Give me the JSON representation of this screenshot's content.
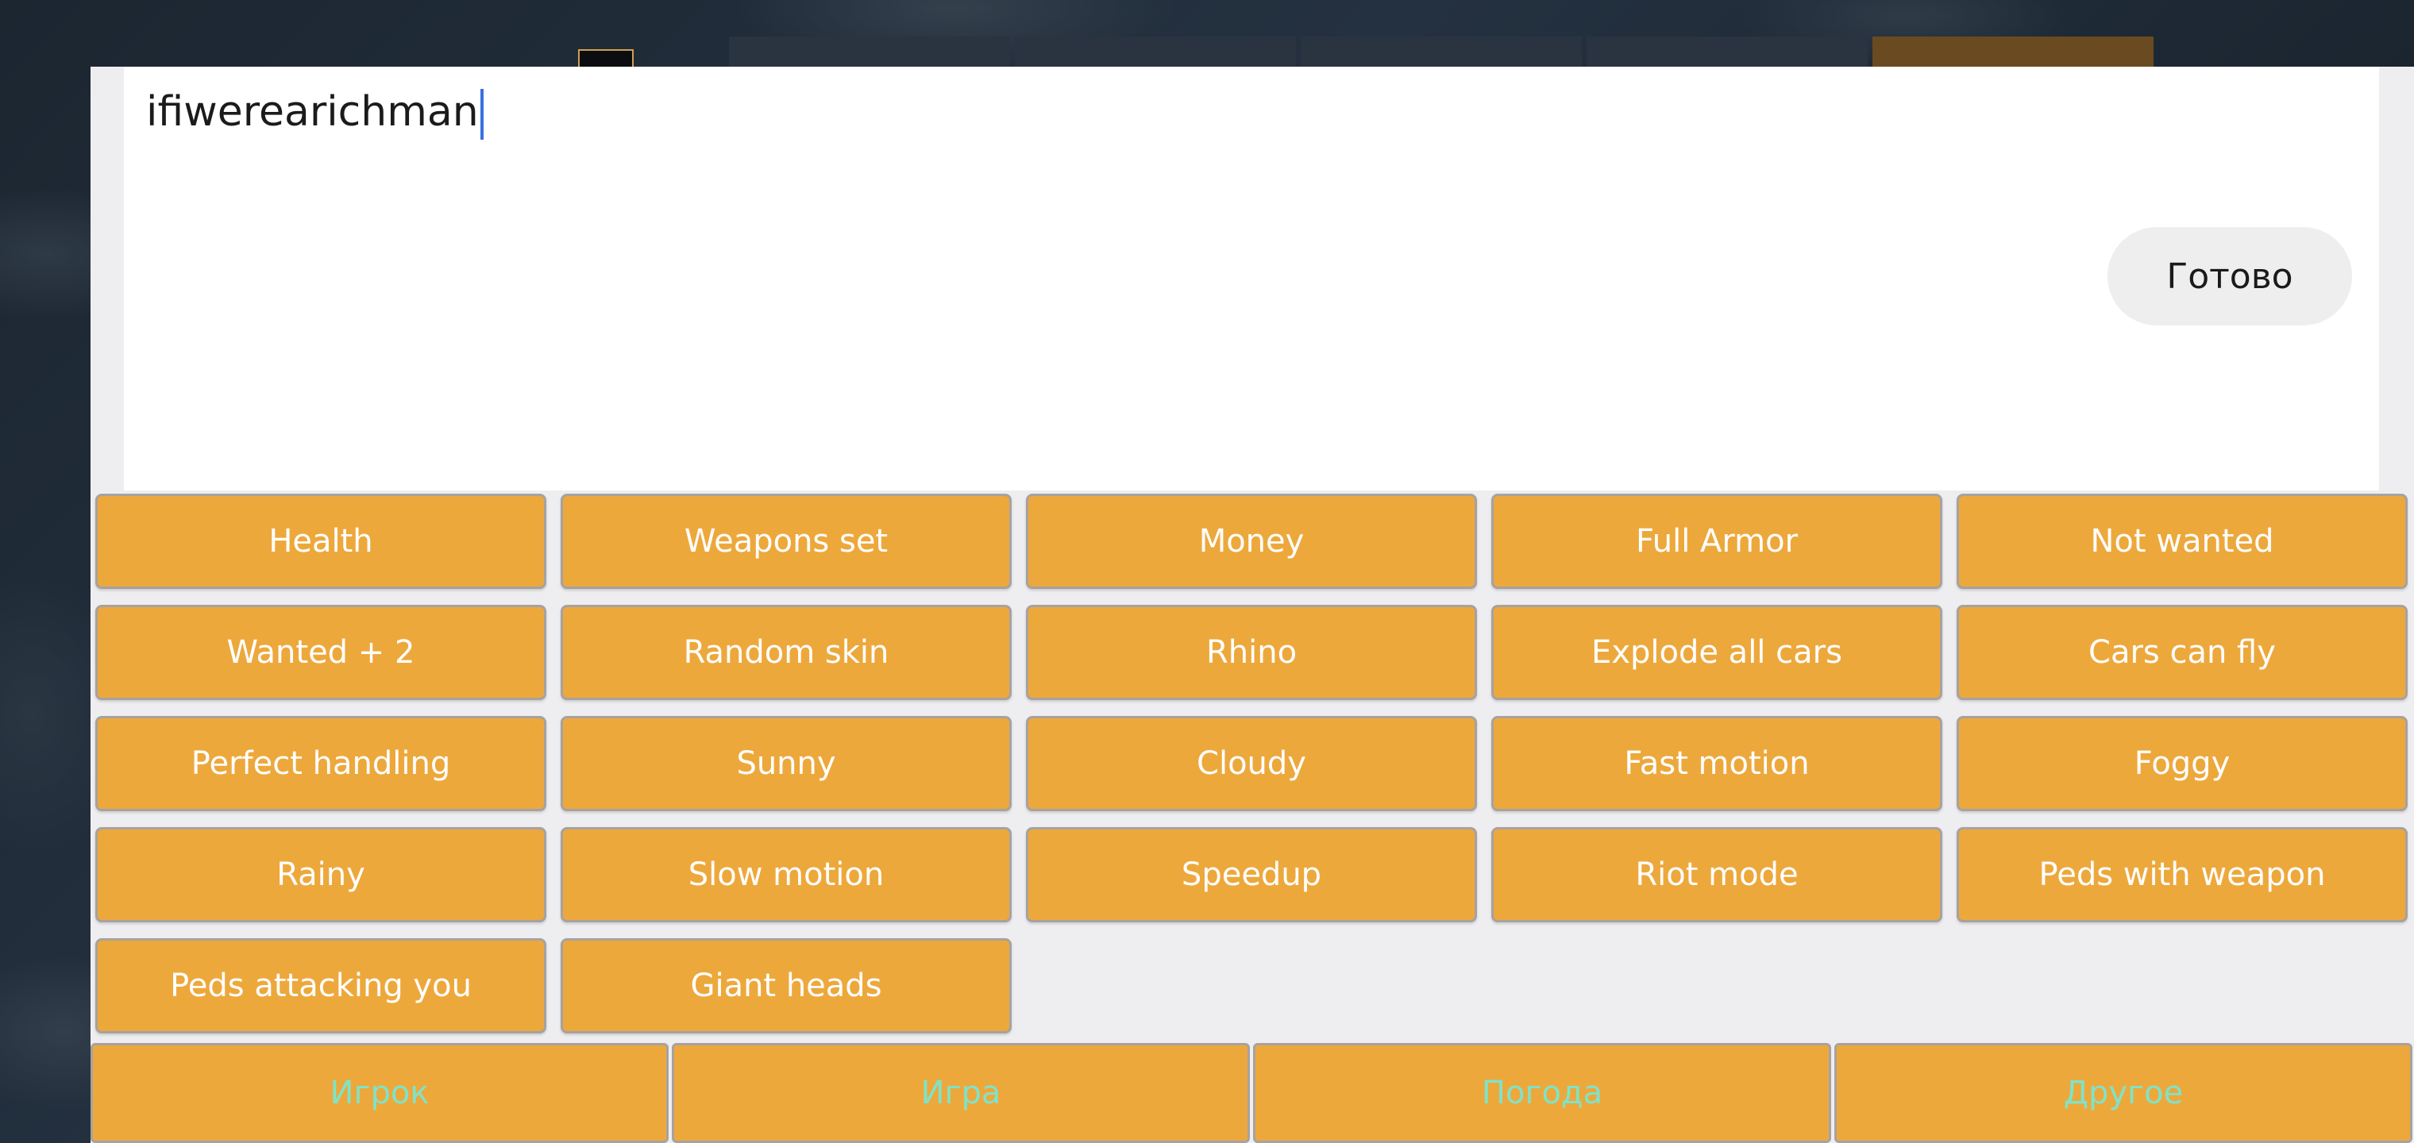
{
  "input": {
    "value": "ifiwerearichman"
  },
  "done_button": {
    "label": "Готово"
  },
  "cheats": [
    "Health",
    "Weapons set",
    "Money",
    "Full Armor",
    "Not wanted",
    "Wanted + 2",
    "Random skin",
    "Rhino",
    "Explode all cars",
    "Cars can fly",
    "Perfect handling",
    "Sunny",
    "Cloudy",
    "Fast motion",
    "Foggy",
    "Rainy",
    "Slow motion",
    "Speedup",
    "Riot mode",
    "Peds with weapon",
    "Peds attacking you",
    "Giant heads"
  ],
  "tabs": [
    "Игрок",
    "Игра",
    "Погода",
    "Другое"
  ],
  "colors": {
    "button_orange": "#eda83c",
    "tab_text_teal": "#7fe3c9",
    "caret_blue": "#3a6fe0"
  }
}
